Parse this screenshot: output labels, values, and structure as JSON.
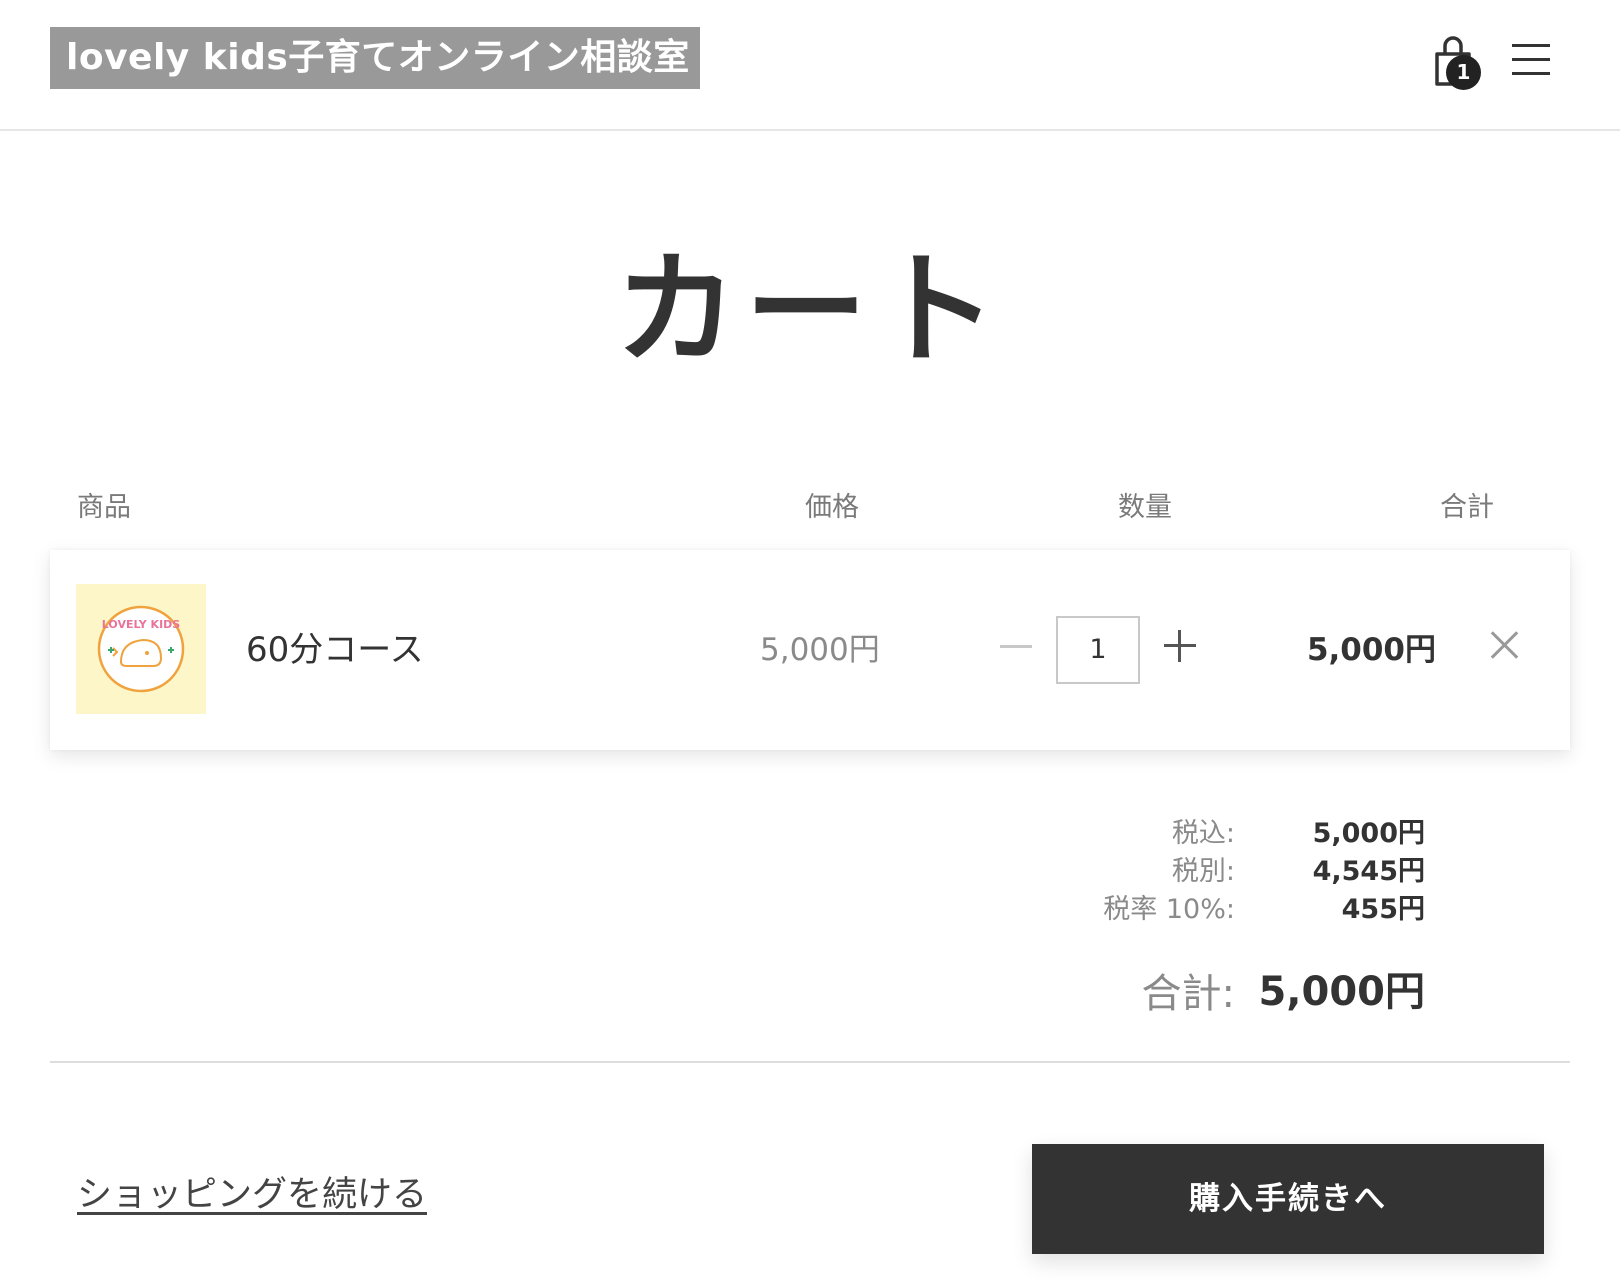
{
  "header": {
    "logo_text": "lovely kids子育てオンライン相談室",
    "cart_count": "1"
  },
  "page": {
    "title": "カート"
  },
  "table": {
    "headers": {
      "product": "商品",
      "price": "価格",
      "quantity": "数量",
      "total": "合計"
    }
  },
  "cart": {
    "items": [
      {
        "thumbnail_text": "LOVELY KIDS",
        "name": "60分コース",
        "unit_price": "5,000円",
        "quantity": "1",
        "line_total": "5,000円"
      }
    ]
  },
  "summary": {
    "tax_included_label": "税込:",
    "tax_included_value": "5,000円",
    "tax_excluded_label": "税別:",
    "tax_excluded_value": "4,545円",
    "tax_rate_label": "税率 10%:",
    "tax_rate_value": "455円",
    "grand_total_label": "合計:",
    "grand_total_value": "5,000円"
  },
  "actions": {
    "continue_shopping": "ショッピングを続ける",
    "checkout": "購入手続きへ"
  },
  "colors": {
    "logo_bg": "#999999",
    "primary_button": "#333333",
    "thumb_bg": "#fdf6c9",
    "logo_pink": "#e8749a",
    "logo_orange": "#f0a23c",
    "logo_green": "#3aa86b"
  }
}
